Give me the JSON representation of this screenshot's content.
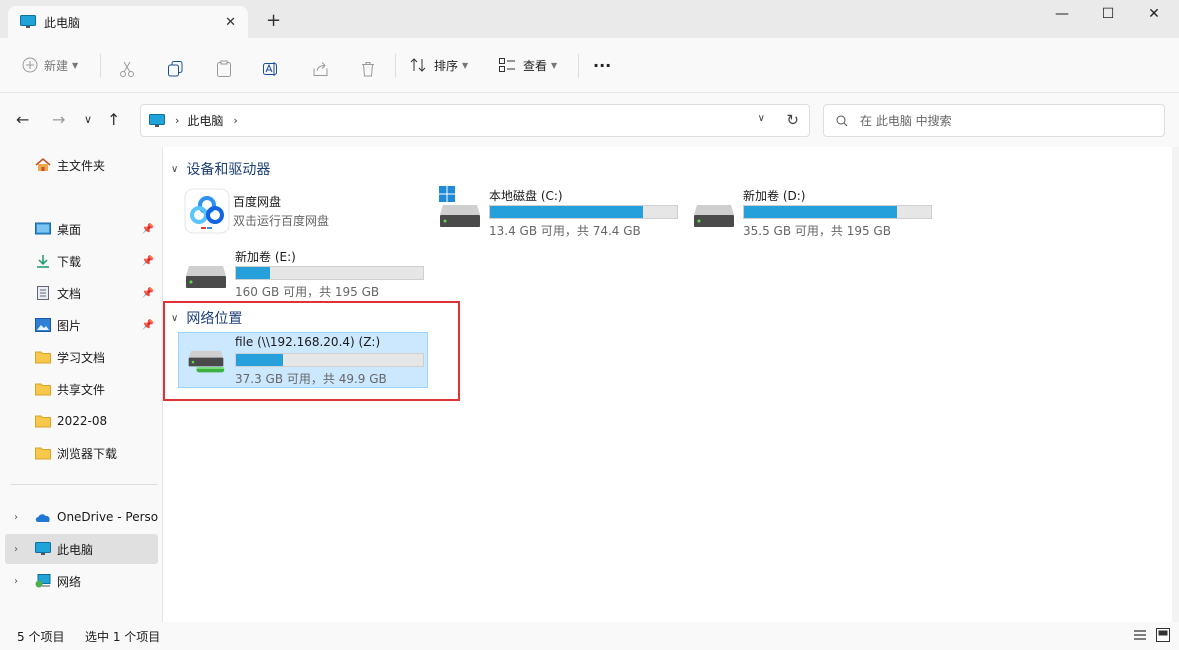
{
  "window": {
    "tab_title": "此电脑",
    "close_glyph": "✕",
    "newtab_glyph": "+",
    "minimize_glyph": "—",
    "maximize_glyph": "☐",
    "winclose_glyph": "✕"
  },
  "toolbar": {
    "new_label": "新建",
    "sort_label": "排序",
    "view_label": "查看",
    "more_glyph": "···"
  },
  "navbar": {
    "address_crumb": "此电脑",
    "search_placeholder": "在 此电脑 中搜索"
  },
  "sidebar": {
    "home": "主文件夹",
    "pinned": [
      {
        "label": "桌面",
        "icon": "desktop-icon"
      },
      {
        "label": "下载",
        "icon": "download-icon"
      },
      {
        "label": "文档",
        "icon": "document-icon"
      },
      {
        "label": "图片",
        "icon": "pictures-icon"
      },
      {
        "label": "学习文档",
        "icon": "folder-icon"
      },
      {
        "label": "共享文件",
        "icon": "folder-icon"
      },
      {
        "label": "2022-08",
        "icon": "folder-icon"
      },
      {
        "label": "浏览器下载",
        "icon": "folder-icon"
      }
    ],
    "onedrive": "OneDrive - Perso",
    "thispc": "此电脑",
    "network": "网络"
  },
  "main": {
    "devices_header": "设备和驱动器",
    "network_header": "网络位置",
    "baidu": {
      "name": "百度网盘",
      "desc": "双击运行百度网盘"
    },
    "drives": [
      {
        "name": "本地磁盘 (C:)",
        "info": "13.4 GB 可用，共 74.4 GB",
        "used_fraction": 0.82
      },
      {
        "name": "新加卷 (D:)",
        "info": "35.5 GB 可用，共 195 GB",
        "used_fraction": 0.82
      },
      {
        "name": "新加卷 (E:)",
        "info": "160 GB 可用，共 195 GB",
        "used_fraction": 0.18
      }
    ],
    "network_drive": {
      "name": "file (\\\\192.168.20.4) (Z:)",
      "info": "37.3 GB 可用，共 49.9 GB",
      "used_fraction": 0.25
    }
  },
  "status": {
    "count": "5 个项目",
    "selected": "选中 1 个项目"
  },
  "colors": {
    "accent": "#26a0da",
    "selection": "#cce8ff",
    "highlight_box": "#e03333",
    "group_header": "#1d3f78"
  }
}
